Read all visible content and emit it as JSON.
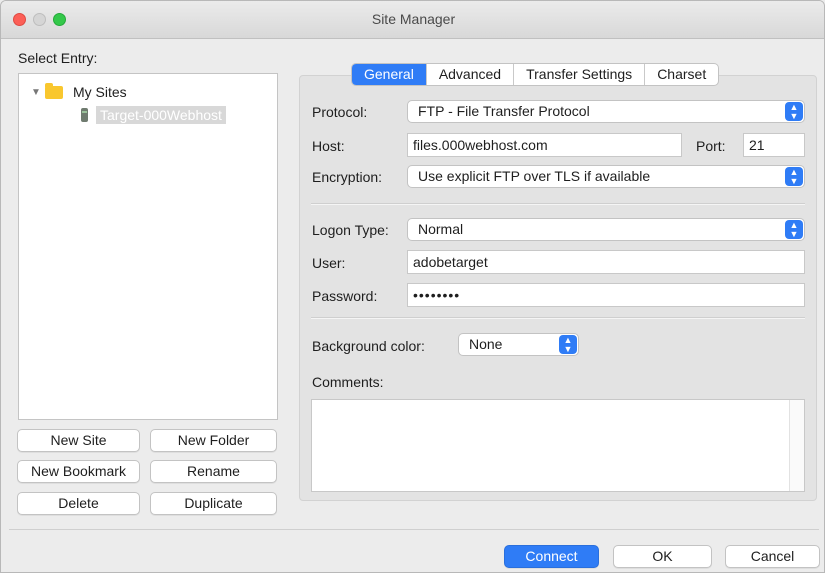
{
  "window": {
    "title": "Site Manager"
  },
  "left": {
    "select_entry_label": "Select Entry:",
    "tree": {
      "folder": "My Sites",
      "site": "Target-000Webhost"
    },
    "buttons": {
      "new_site": "New Site",
      "new_folder": "New Folder",
      "new_bookmark": "New Bookmark",
      "rename": "Rename",
      "delete": "Delete",
      "duplicate": "Duplicate"
    }
  },
  "tabs": [
    "General",
    "Advanced",
    "Transfer Settings",
    "Charset"
  ],
  "general": {
    "protocol_label": "Protocol:",
    "protocol_value": "FTP - File Transfer Protocol",
    "host_label": "Host:",
    "host_value": "files.000webhost.com",
    "port_label": "Port:",
    "port_value": "21",
    "encryption_label": "Encryption:",
    "encryption_value": "Use explicit FTP over TLS if available",
    "logon_type_label": "Logon Type:",
    "logon_type_value": "Normal",
    "user_label": "User:",
    "user_value": "adobetarget",
    "password_label": "Password:",
    "password_value": "••••••••",
    "bg_color_label": "Background color:",
    "bg_color_value": "None",
    "comments_label": "Comments:"
  },
  "footer": {
    "connect": "Connect",
    "ok": "OK",
    "cancel": "Cancel"
  },
  "colors": {
    "accent": "#2f7cf6",
    "folder": "#f9c72e"
  }
}
